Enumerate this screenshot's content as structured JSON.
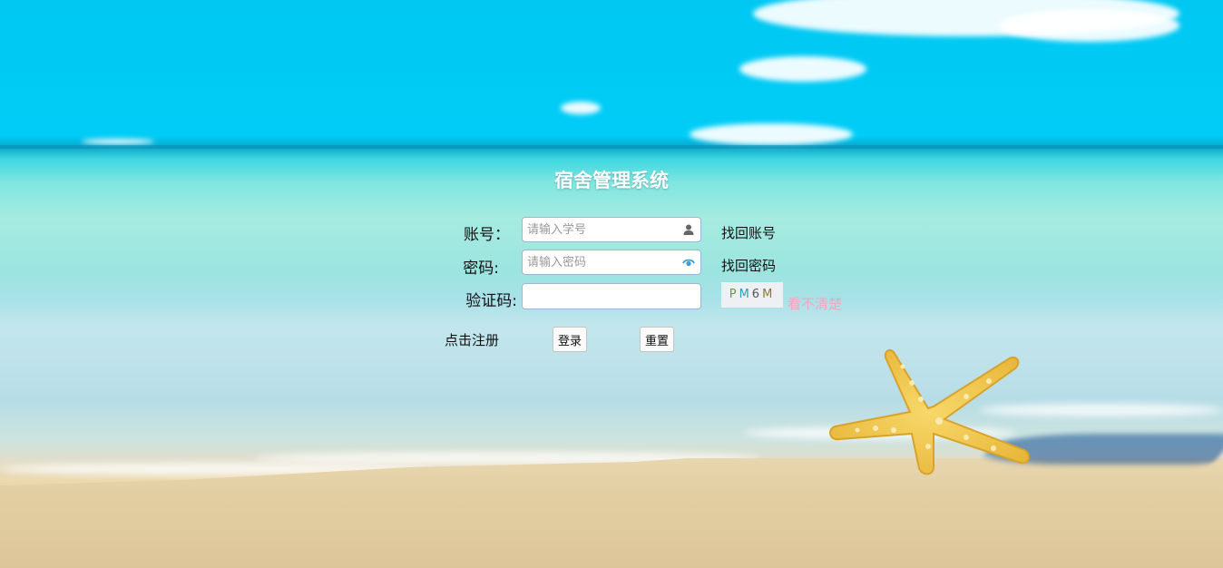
{
  "app": {
    "title": "宿舍管理系统"
  },
  "form": {
    "account_label": "账号：",
    "account_placeholder": "请输入学号",
    "password_label": "密码:",
    "password_placeholder": "请输入密码",
    "captcha_label": "验证码:",
    "captcha_value": "",
    "captcha_chars": [
      "P",
      "M",
      "6",
      "M"
    ],
    "captcha_refresh": "看不清楚"
  },
  "links": {
    "recover_account": "找回账号",
    "recover_password": "找回密码",
    "register": "点击注册"
  },
  "buttons": {
    "login": "登录",
    "reset": "重置"
  },
  "icons": {
    "user": "user-icon",
    "eye": "eye-icon"
  },
  "colors": {
    "refresh_link": "#f1a7bf",
    "eye_icon": "#3a9fd6"
  }
}
